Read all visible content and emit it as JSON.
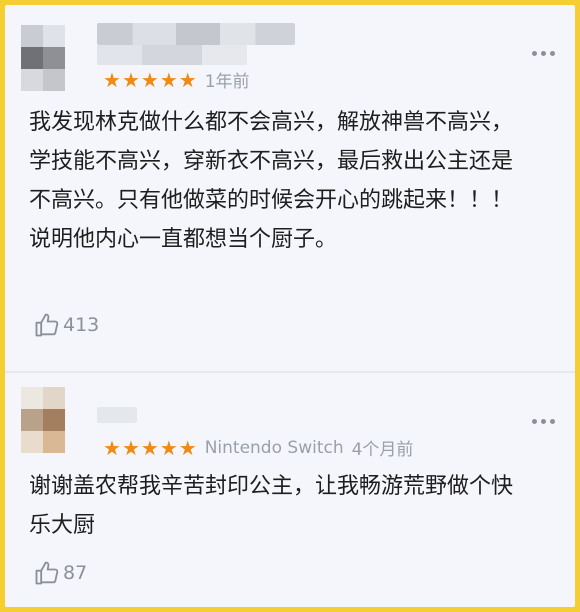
{
  "reviews": [
    {
      "rating": 5,
      "platform": "",
      "time": "1年前",
      "text": "我发现林克做什么都不会高兴，解放神兽不高兴，学技能不高兴，穿新衣不高兴，最后救出公主还是不高兴。只有他做菜的时候会开心的跳起来！！！说明他内心一直都想当个厨子。",
      "likes": "413"
    },
    {
      "rating": 5,
      "platform": "Nintendo Switch",
      "time": "4个月前",
      "text": "谢谢盖农帮我辛苦封印公主，让我畅游荒野做个快乐大厨",
      "likes": "87"
    }
  ],
  "icons": {
    "star": "star-icon",
    "more": "more-icon",
    "like": "thumbs-up-icon"
  },
  "colors": {
    "accent_star": "#f08a13",
    "frame": "#f5cf31",
    "muted": "#9aa0a9"
  }
}
